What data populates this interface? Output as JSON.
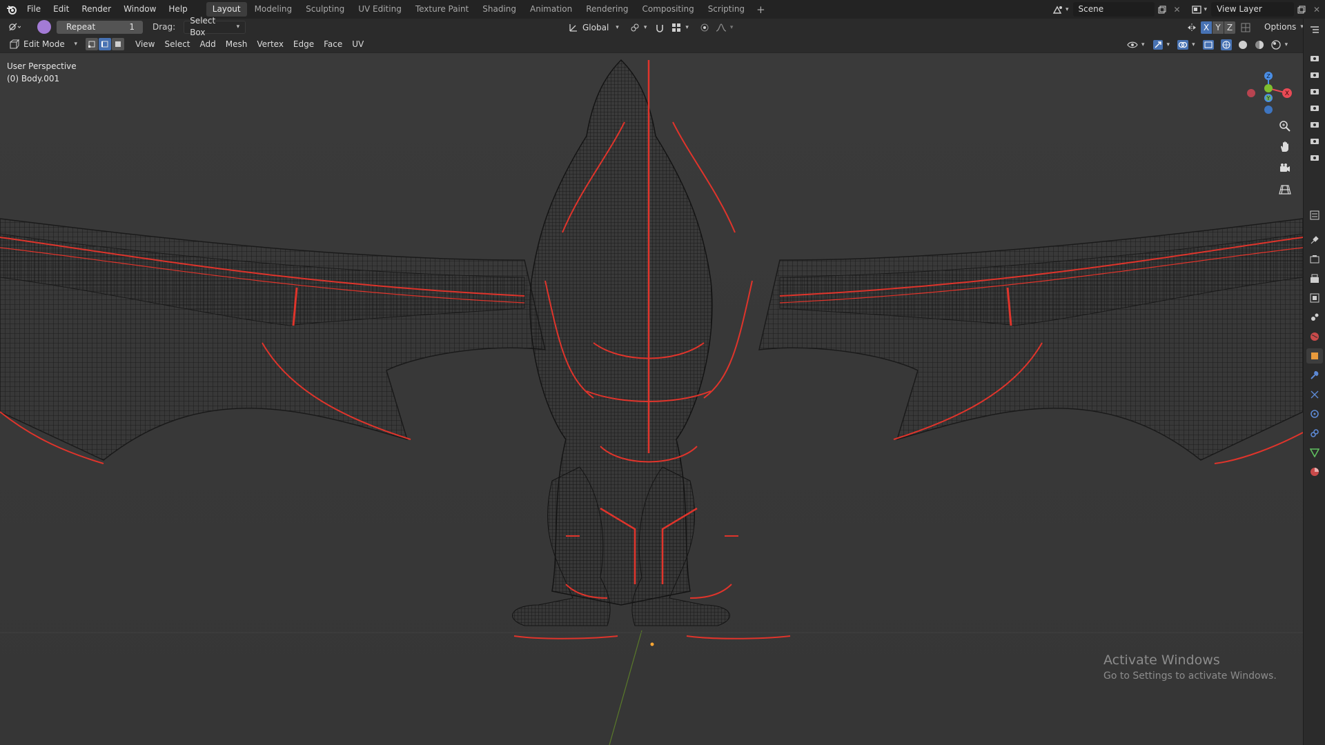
{
  "topbar": {
    "menus": [
      "File",
      "Edit",
      "Render",
      "Window",
      "Help"
    ],
    "workspaces": [
      "Layout",
      "Modeling",
      "Sculpting",
      "UV Editing",
      "Texture Paint",
      "Shading",
      "Animation",
      "Rendering",
      "Compositing",
      "Scripting"
    ],
    "active_workspace": "Layout",
    "add_tab": "+",
    "scene": "Scene",
    "view_layer": "View Layer"
  },
  "toolbar": {
    "repeat_label": "Repeat",
    "repeat_count": "1",
    "drag_label": "Drag:",
    "drag_value": "Select Box",
    "orientation": "Global",
    "options": "Options",
    "axis_x": "X",
    "axis_y": "Y",
    "axis_z": "Z"
  },
  "header": {
    "mode": "Edit Mode",
    "menus": [
      "View",
      "Select",
      "Add",
      "Mesh",
      "Vertex",
      "Edge",
      "Face",
      "UV"
    ]
  },
  "viewport": {
    "perspective": "User Perspective",
    "object": "(0) Body.001",
    "gizmo_x": "X",
    "gizmo_y": "Y",
    "gizmo_z": "Z"
  },
  "watermark": {
    "title": "Activate Windows",
    "subtitle": "Go to Settings to activate Windows."
  },
  "colors": {
    "accent": "#4772b3",
    "seam": "#e0342b",
    "wire": "#161616",
    "axis_x": "#e94a55",
    "axis_y": "#7fbf2f",
    "axis_z": "#4a8ee6"
  }
}
